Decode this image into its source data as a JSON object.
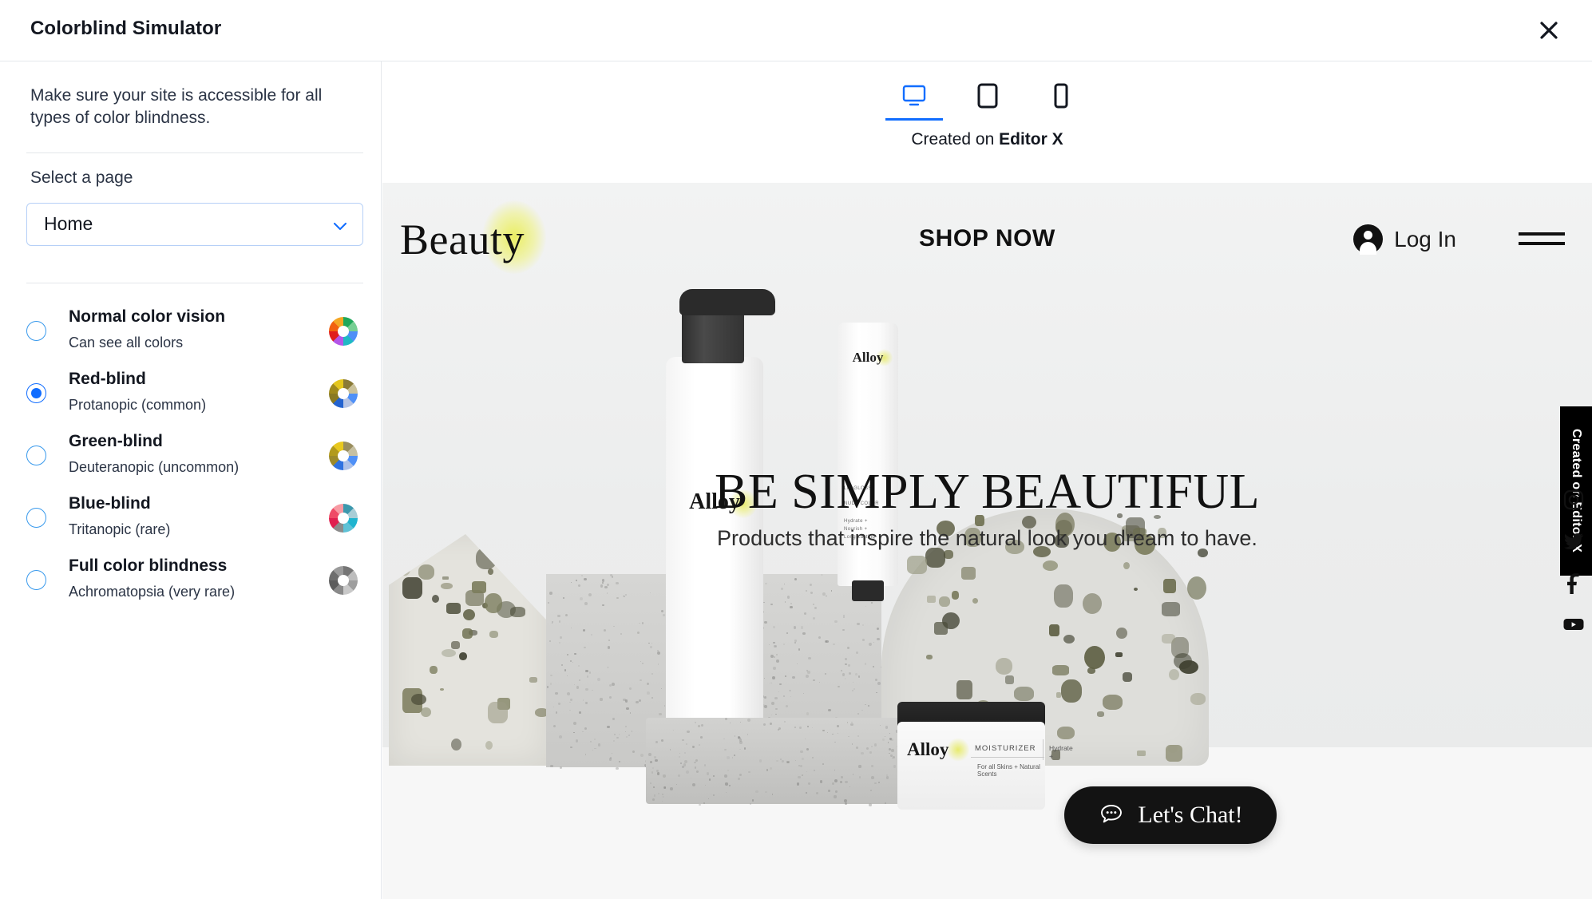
{
  "window": {
    "title": "Colorblind Simulator",
    "close_icon": "close-icon"
  },
  "sidebar": {
    "intro": "Make sure your site is accessible for all types of color blindness.",
    "select_label": "Select a page",
    "page_select": {
      "value": "Home",
      "chevron_icon": "chevron-down-icon"
    },
    "options": [
      {
        "title": "Normal color vision",
        "subtitle": "Can see all colors",
        "selected": false,
        "icon": "color-wheel-icon",
        "wheel_colors": [
          "#1fa85a",
          "#76cf93",
          "#4f8ff7",
          "#1fb9c4",
          "#b456e8",
          "#e01d1d",
          "#f2610f",
          "#f5a623"
        ]
      },
      {
        "title": "Red-blind",
        "subtitle": "Protanopic (common)",
        "selected": true,
        "icon": "color-wheel-icon",
        "wheel_colors": [
          "#8a7a37",
          "#cbc29b",
          "#4f90f7",
          "#b6c4e4",
          "#2463cf",
          "#8a7a22",
          "#a08a1c",
          "#e4c61d"
        ]
      },
      {
        "title": "Green-blind",
        "subtitle": "Deuteranopic (uncommon)",
        "selected": false,
        "icon": "color-wheel-icon",
        "wheel_colors": [
          "#9a8e5e",
          "#c6c0a2",
          "#4f90f7",
          "#adc1e8",
          "#2f72e0",
          "#9c8a2a",
          "#b29a1c",
          "#e8c81f"
        ]
      },
      {
        "title": "Blue-blind",
        "subtitle": "Tritanopic (rare)",
        "selected": false,
        "icon": "color-wheel-icon",
        "wheel_colors": [
          "#3c98ad",
          "#a8cdd6",
          "#1fb4cf",
          "#5fc2d6",
          "#8c8c8c",
          "#e0204f",
          "#ef4a66",
          "#f79aa3"
        ]
      },
      {
        "title": "Full color blindness",
        "subtitle": "Achromatopsia (very rare)",
        "selected": false,
        "icon": "color-wheel-icon",
        "wheel_colors": [
          "#757575",
          "#bdbdbd",
          "#9e9e9e",
          "#c9c9c9",
          "#8a8a8a",
          "#5c5c5c",
          "#6e6e6e",
          "#9a9a9a"
        ]
      }
    ]
  },
  "preview": {
    "devices": [
      {
        "name": "desktop",
        "icon": "desktop-icon",
        "active": true
      },
      {
        "name": "tablet",
        "icon": "tablet-icon",
        "active": false
      },
      {
        "name": "mobile",
        "icon": "mobile-icon",
        "active": false
      }
    ],
    "created_on_prefix": "Created on ",
    "created_on_brand": "Editor X"
  },
  "site": {
    "logo": "Beauty",
    "nav_shop": "SHOP NOW",
    "login": "Log In",
    "menu_icon": "hamburger-menu-icon",
    "avatar_icon": "account-avatar-icon",
    "hero_title": "BE SIMPLY BEAUTIFUL",
    "hero_subtitle": "Products that inspire the natural look you dream to have.",
    "products": {
      "bottle_brand": "Alloy",
      "tube_brand": "Alloy",
      "tube_line1": "LIP GLOSS",
      "tube_line2": "NUDE COLOR",
      "tube_line3": "Hydrate +",
      "tube_line4": "Nourish +",
      "tube_line5": "Long Lasting",
      "jar_brand": "Alloy",
      "jar_product": "MOISTURIZER",
      "jar_desc": "For all Skins + Natural Scents",
      "jar_tag": "Hydrate +"
    },
    "editor_x_tab": "Created on Editor X",
    "social": [
      {
        "name": "instagram",
        "icon": "instagram-icon"
      },
      {
        "name": "twitter",
        "icon": "twitter-icon"
      },
      {
        "name": "facebook",
        "icon": "facebook-icon"
      },
      {
        "name": "youtube",
        "icon": "youtube-icon"
      }
    ],
    "chat": {
      "label": "Let's Chat!",
      "icon": "chat-bubble-icon"
    }
  },
  "colors": {
    "accent_blue": "#116dff",
    "text_dark": "#131720",
    "border": "#e5e8ec"
  }
}
